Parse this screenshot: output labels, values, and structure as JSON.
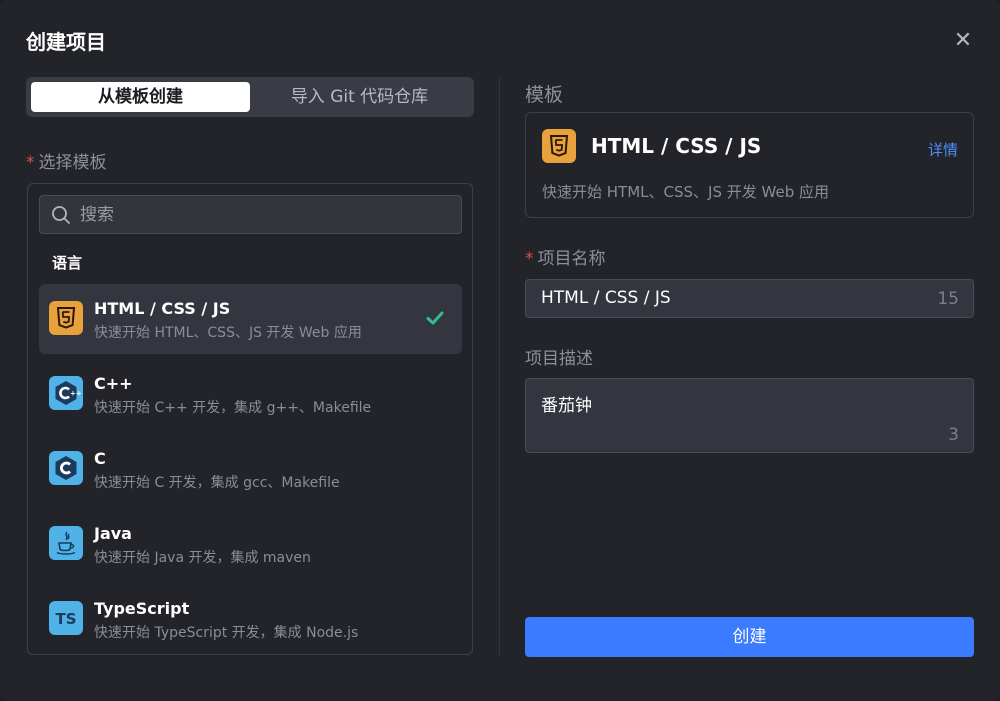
{
  "dialog": {
    "title": "创建项目",
    "close_glyph": "✕"
  },
  "tabs": [
    {
      "label": "从模板创建",
      "active": true
    },
    {
      "label": "导入 Git 代码仓库",
      "active": false
    }
  ],
  "template_select": {
    "required_mark": "*",
    "label": "选择模板",
    "search_placeholder": "搜索",
    "group_label": "语言",
    "items": [
      {
        "name": "HTML / CSS / JS",
        "desc": "快速开始 HTML、CSS、JS 开发 Web 应用",
        "icon": "html5-icon",
        "selected": true
      },
      {
        "name": "C++",
        "desc": "快速开始 C++ 开发，集成 g++、Makefile",
        "icon": "cpp-icon",
        "selected": false
      },
      {
        "name": "C",
        "desc": "快速开始 C 开发，集成 gcc、Makefile",
        "icon": "c-icon",
        "selected": false
      },
      {
        "name": "Java",
        "desc": "快速开始 Java 开发，集成 maven",
        "icon": "java-icon",
        "selected": false
      },
      {
        "name": "TypeScript",
        "desc": "快速开始 TypeScript 开发，集成 Node.js",
        "icon": "typescript-icon",
        "selected": false
      }
    ]
  },
  "template_preview": {
    "section_label": "模板",
    "name": "HTML / CSS / JS",
    "details_link": "详情",
    "desc": "快速开始 HTML、CSS、JS 开发 Web 应用",
    "icon": "html5-icon"
  },
  "project_name": {
    "required_mark": "*",
    "label": "项目名称",
    "value": "HTML / CSS / JS",
    "count": "15"
  },
  "project_desc": {
    "label": "项目描述",
    "value": "番茄钟",
    "count": "3"
  },
  "create_button": {
    "label": "创建"
  },
  "colors": {
    "accent": "#3b7bff",
    "html_orange": "#e9a13b",
    "lang_blue": "#4fb3e8",
    "check_green": "#2fbf8a",
    "required_red": "#e54b4b"
  }
}
